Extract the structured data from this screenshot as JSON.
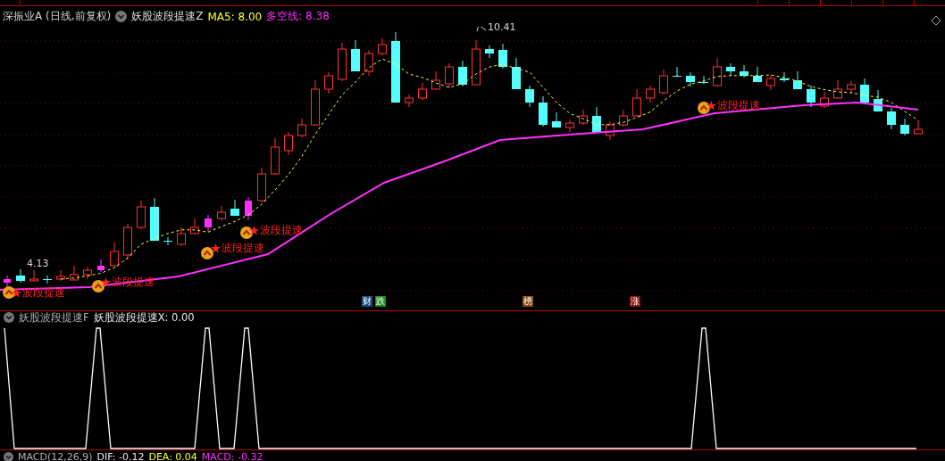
{
  "header": {
    "stock": "深振业A (日线,前复权)",
    "indicator": "妖股波段提速Z",
    "ma5": "MA5: 8.00",
    "long_short": "多空线: 8.38"
  },
  "price_labels": [
    {
      "text": "10.41"
    },
    {
      "text": "4.13"
    }
  ],
  "signals": [
    {
      "label": "波段提速"
    },
    {
      "label": "波段提速"
    },
    {
      "label": "波段提速"
    },
    {
      "label": "波段提速"
    },
    {
      "label": "波段提速"
    }
  ],
  "event_badges": [
    {
      "text": "财",
      "color": "#1b4a7a"
    },
    {
      "text": "跌",
      "color": "#1a8a1a"
    },
    {
      "text": "榜",
      "color": "#8a4a12"
    },
    {
      "text": "涨",
      "color": "#8a1010"
    }
  ],
  "sub_panel": {
    "title": "妖股波段提速F",
    "value": "妖股波段提速X: 0.00"
  },
  "macd": {
    "name": "MACD(12,26,9)",
    "dif": "DIF: -0.12",
    "dea": "DEA: 0.04",
    "macd": "MACD: -0.32"
  }
}
